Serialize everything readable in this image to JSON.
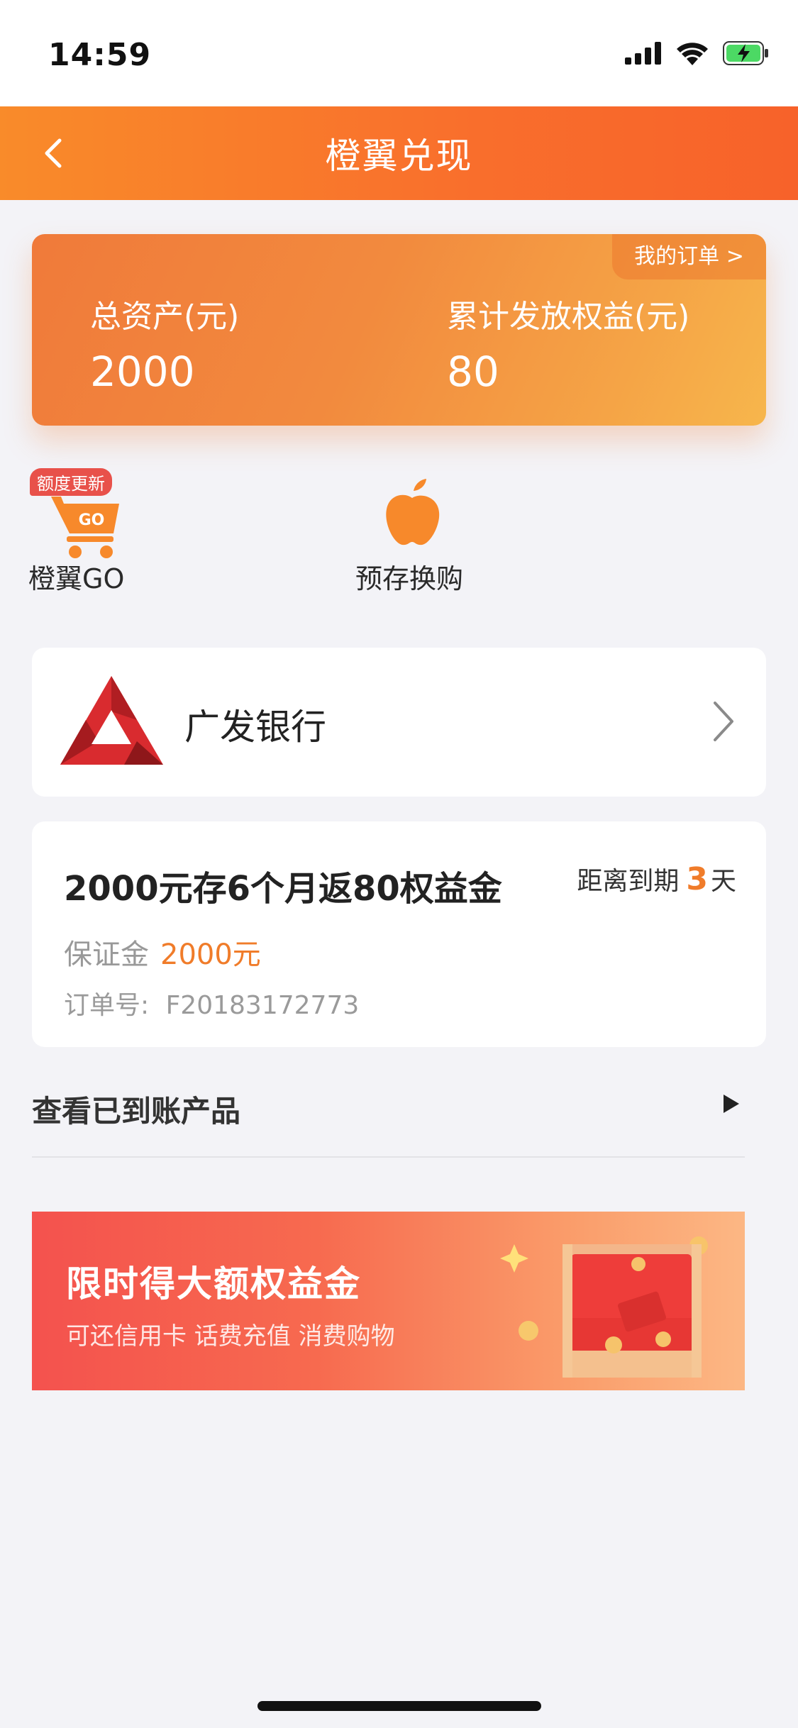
{
  "status_bar": {
    "time": "14:59",
    "icons": [
      "signal-icon",
      "wifi-icon",
      "battery-charging-icon"
    ]
  },
  "nav": {
    "back_icon": "chevron-left-icon",
    "title": "橙翼兑现"
  },
  "asset_card": {
    "orders_link": "我的订单 >",
    "total_assets_label": "总资产(元)",
    "total_assets_value": "2000",
    "benefits_label": "累计发放权益(元)",
    "benefits_value": "80"
  },
  "quick_entries": [
    {
      "label": "橙翼GO",
      "badge": "额度更新",
      "icon_text": "GO",
      "icon": "shopping-cart-icon"
    },
    {
      "label": "预存换购",
      "icon": "apple-icon"
    }
  ],
  "bank": {
    "name": "广发银行",
    "logo": "cgb-bank-logo",
    "chevron": "chevron-right-icon"
  },
  "product": {
    "title": "2000元存6个月返80权益金",
    "expiry_prefix": "距离到期",
    "expiry_days": "3",
    "expiry_suffix": "天",
    "deposit_label": "保证金",
    "deposit_value": "2000元",
    "order_label": "订单号:",
    "order_number": "F20183172773"
  },
  "arrived": {
    "label": "查看已到账产品",
    "arrow_icon": "triangle-right-icon"
  },
  "promo": {
    "title": "限时得大额权益金",
    "subtitle": "可还信用卡 话费充值 消费购物",
    "image": "treasure-chest-illustration"
  },
  "colors": {
    "accent": "#f96e2c",
    "highlight": "#f07c2a",
    "promo": "#f4524e"
  }
}
